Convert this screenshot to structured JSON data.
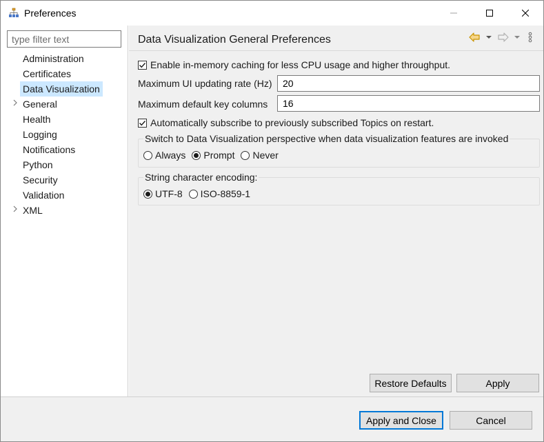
{
  "window": {
    "title": "Preferences",
    "icon": "preferences-tree-icon"
  },
  "filter": {
    "placeholder": "type filter text",
    "value": ""
  },
  "tree": {
    "items": [
      {
        "label": "Administration",
        "expandable": false,
        "selected": false
      },
      {
        "label": "Certificates",
        "expandable": false,
        "selected": false
      },
      {
        "label": "Data Visualization",
        "expandable": false,
        "selected": true
      },
      {
        "label": "General",
        "expandable": true,
        "selected": false
      },
      {
        "label": "Health",
        "expandable": false,
        "selected": false
      },
      {
        "label": "Logging",
        "expandable": false,
        "selected": false
      },
      {
        "label": "Notifications",
        "expandable": false,
        "selected": false
      },
      {
        "label": "Python",
        "expandable": false,
        "selected": false
      },
      {
        "label": "Security",
        "expandable": false,
        "selected": false
      },
      {
        "label": "Validation",
        "expandable": false,
        "selected": false
      },
      {
        "label": "XML",
        "expandable": true,
        "selected": false
      }
    ]
  },
  "page": {
    "title": "Data Visualization General Preferences",
    "caching": {
      "label": "Enable in-memory caching for less CPU usage and higher throughput.",
      "checked": true
    },
    "update_rate": {
      "label": "Maximum UI updating rate (Hz)",
      "value": "20"
    },
    "key_columns": {
      "label": "Maximum default key columns",
      "value": "16"
    },
    "auto_subscribe": {
      "label": "Automatically subscribe to previously subscribed Topics on restart.",
      "checked": true
    },
    "perspective": {
      "title": "Switch to Data Visualization perspective when data visualization features are invoked",
      "options": [
        {
          "label": "Always",
          "selected": false
        },
        {
          "label": "Prompt",
          "selected": true
        },
        {
          "label": "Never",
          "selected": false
        }
      ]
    },
    "encoding": {
      "title": "String character encoding:",
      "options": [
        {
          "label": "UTF-8",
          "selected": true
        },
        {
          "label": "ISO-8859-1",
          "selected": false
        }
      ]
    },
    "restore_defaults_label": "Restore Defaults",
    "apply_label": "Apply"
  },
  "footer": {
    "apply_close_label": "Apply and Close",
    "cancel_label": "Cancel"
  },
  "colors": {
    "selection": "#cce8ff",
    "accent": "#0078d7",
    "nav_back": "#d9a400",
    "disabled": "#a8a8a8"
  }
}
